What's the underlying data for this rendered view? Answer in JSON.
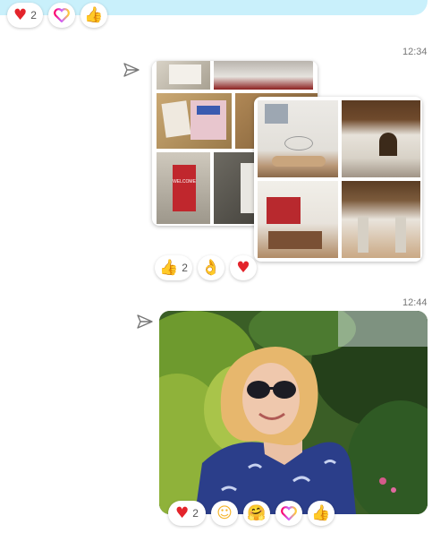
{
  "top_reactions": [
    {
      "icon": "heart-icon",
      "glyph": "♥",
      "count": "2"
    },
    {
      "icon": "heart-outline-icon",
      "glyph": "♡",
      "count": ""
    },
    {
      "icon": "thumbs-up-icon",
      "glyph": "👍",
      "count": ""
    }
  ],
  "message1": {
    "time": "12:34",
    "reactions": [
      {
        "icon": "thumbs-up-icon",
        "glyph": "👍",
        "count": "2"
      },
      {
        "icon": "ok-hand-icon",
        "glyph": "👌",
        "count": ""
      },
      {
        "icon": "heart-icon",
        "glyph": "♥",
        "count": ""
      }
    ]
  },
  "message2": {
    "time": "12:44",
    "reactions": [
      {
        "icon": "heart-icon",
        "glyph": "♥",
        "count": "2"
      },
      {
        "icon": "smile-icon",
        "glyph": "☺",
        "count": ""
      },
      {
        "icon": "hug-icon",
        "glyph": "🤗",
        "count": ""
      },
      {
        "icon": "heart-outline-icon",
        "glyph": "♡",
        "count": ""
      },
      {
        "icon": "thumbs-up-icon",
        "glyph": "👍",
        "count": ""
      }
    ]
  },
  "poster_text": "WELCOME",
  "colors": {
    "bubble": "#c9f0fb",
    "heart": "#e3242b",
    "thumb": "#f2b61e"
  }
}
